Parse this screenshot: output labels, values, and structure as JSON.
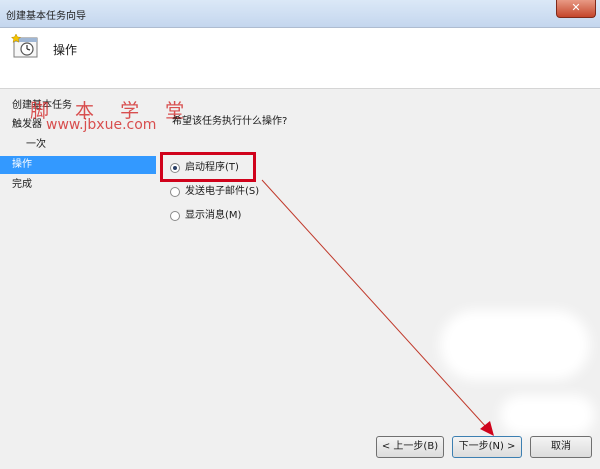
{
  "window": {
    "title": "创建基本任务向导",
    "close_glyph": "✕"
  },
  "header": {
    "icon": "task-clock-icon",
    "title": "操作"
  },
  "steps": [
    {
      "label": "创建基本任务",
      "active": false
    },
    {
      "label": "触发器",
      "active": false
    },
    {
      "label": "一次",
      "active": false
    },
    {
      "label": "操作",
      "active": true
    },
    {
      "label": "完成",
      "active": false
    }
  ],
  "watermark": {
    "line1": "脚 本 学 堂",
    "line2": "www.jbxue.com"
  },
  "content": {
    "question": "希望该任务执行什么操作?",
    "options": [
      {
        "label": "启动程序(T)",
        "selected": true
      },
      {
        "label": "发送电子邮件(S)",
        "selected": false
      },
      {
        "label": "显示消息(M)",
        "selected": false
      }
    ]
  },
  "buttons": {
    "back": "< 上一步(B)",
    "next": "下一步(N) >",
    "cancel": "取消"
  },
  "colors": {
    "selection": "#3399ff",
    "annotation": "#d0021b"
  }
}
